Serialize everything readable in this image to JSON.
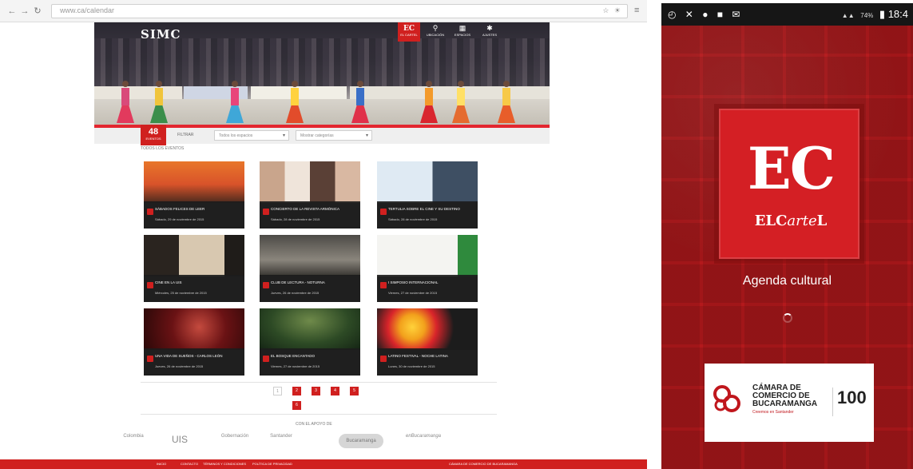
{
  "browser": {
    "url": "www.ca/calendar",
    "site": {
      "logo": "SIMC",
      "logo_sub": "",
      "ec_badge": "EC",
      "ec_badge_sub": "EL CARTEL",
      "nav": [
        {
          "icon": "map-pin-icon",
          "label": "UBICACIÓN"
        },
        {
          "icon": "building-icon",
          "label": "ESPACIOS"
        },
        {
          "icon": "settings-icon",
          "label": "AJUSTES"
        }
      ]
    },
    "filter": {
      "date_day": "48",
      "date_sub": "EVENTOS",
      "label": "FILTRAR",
      "select_1": "Todos los espacios",
      "select_2": "Mostrar categorías",
      "all_events": "TODOS LOS EVENTOS"
    },
    "events": [
      {
        "title": "SÁBADOS FELICES DE LEER",
        "date": "Sábado, 29 de noviembre de 2015"
      },
      {
        "title": "CONCIERTO DE LA REVISTA ARMÓNICA",
        "date": "Sábado, 28 de noviembre de 2015"
      },
      {
        "title": "TERTULIA SOBRE EL CINE Y SU DESTINO",
        "date": "Sábado, 28 de noviembre de 2015"
      },
      {
        "title": "CINE EN LA UIS",
        "date": "Miércoles, 25 de noviembre de 2015"
      },
      {
        "title": "CLUB DE LECTURA - NOTURNA",
        "date": "Jueves, 26 de noviembre de 2015"
      },
      {
        "title": "I SIMPOSIO INTERNACIONAL",
        "date": "Viernes, 27 de noviembre de 2015"
      },
      {
        "title": "UNA VIDA DE SUEÑOS - CARLOS LEÓN",
        "date": "Jueves, 26 de noviembre de 2015"
      },
      {
        "title": "EL BOSQUE ENCANTADO",
        "date": "Viernes, 27 de noviembre de 2015"
      },
      {
        "title": "LATINO FESTIVAL - NOCHE LATINA",
        "date": "Lunes, 30 de noviembre de 2015"
      }
    ],
    "pagination": [
      "1",
      "2",
      "3",
      "4",
      "5",
      "6"
    ],
    "sponsors_title": "CON EL APOYO DE",
    "sponsors": [
      "Colombia",
      "UIS",
      "Gobernación",
      "Santander",
      "Bucaramanga",
      "enBucaramanga"
    ],
    "footer_links": [
      "INICIO",
      "CONTACTO",
      "TÉRMINOS Y CONDICIONES",
      "POLÍTICA DE PRIVACIDAD"
    ],
    "footer_right": "CÁMARA DE COMERCIO DE BUCARAMANGA"
  },
  "phone": {
    "status_time": "18:4",
    "status_battery": "74%",
    "logo_main": "EC",
    "logo_sub_a": "ELC",
    "logo_sub_b": "arte",
    "logo_sub_c": "L",
    "subtitle": "Agenda cultural",
    "sponsor_name": "CÁMARA DE COMERCIO DE BUCARAMANGA",
    "sponsor_tag": "Creemos en Santander",
    "sponsor_years": "100",
    "brand_color": "#d41f24"
  }
}
